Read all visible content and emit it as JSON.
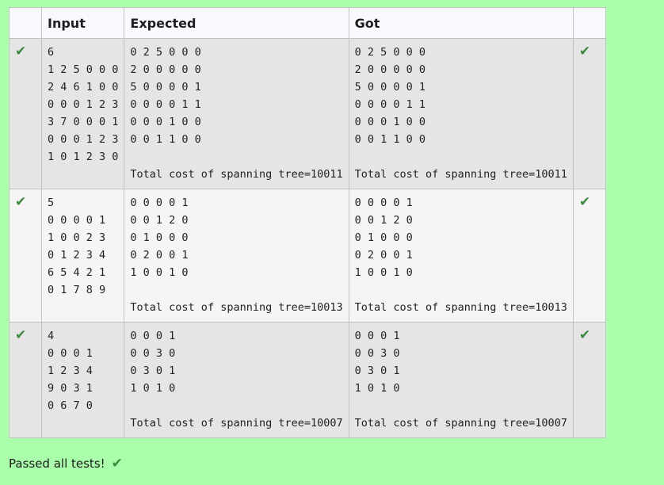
{
  "table": {
    "headers": [
      "",
      "Input",
      "Expected",
      "Got",
      ""
    ],
    "rows": [
      {
        "input": "6\n1 2 5 0 0 0\n2 4 6 1 0 0\n0 0 0 1 2 3\n3 7 0 0 0 1\n0 0 0 1 2 3\n1 0 1 2 3 0",
        "expected": "0 2 5 0 0 0\n2 0 0 0 0 0\n5 0 0 0 0 1\n0 0 0 0 1 1\n0 0 0 1 0 0\n0 0 1 1 0 0\n\nTotal cost of spanning tree=10011",
        "got": "0 2 5 0 0 0\n2 0 0 0 0 0\n5 0 0 0 0 1\n0 0 0 0 1 1\n0 0 0 1 0 0\n0 0 1 1 0 0\n\nTotal cost of spanning tree=10011",
        "status_icon": "check-icon"
      },
      {
        "input": "5\n0 0 0 0 1\n1 0 0 2 3\n0 1 2 3 4\n6 5 4 2 1\n0 1 7 8 9",
        "expected": "0 0 0 0 1\n0 0 1 2 0\n0 1 0 0 0\n0 2 0 0 1\n1 0 0 1 0\n\nTotal cost of spanning tree=10013",
        "got": "0 0 0 0 1\n0 0 1 2 0\n0 1 0 0 0\n0 2 0 0 1\n1 0 0 1 0\n\nTotal cost of spanning tree=10013",
        "status_icon": "check-icon"
      },
      {
        "input": "4\n0 0 0 1\n1 2 3 4\n9 0 3 1\n0 6 7 0",
        "expected": "0 0 0 1\n0 0 3 0\n0 3 0 1\n1 0 1 0\n\nTotal cost of spanning tree=10007",
        "got": "0 0 0 1\n0 0 3 0\n0 3 0 1\n1 0 1 0\n\nTotal cost of spanning tree=10007",
        "status_icon": "check-icon"
      }
    ]
  },
  "summary": {
    "text": "Passed all tests!",
    "icon": "check-icon"
  },
  "colors": {
    "page_background": "#aaffaa",
    "check": "#3c8a3c",
    "row_odd": "#e5e5e5",
    "row_even": "#f5f5f5",
    "header": "#f8f9fe"
  }
}
